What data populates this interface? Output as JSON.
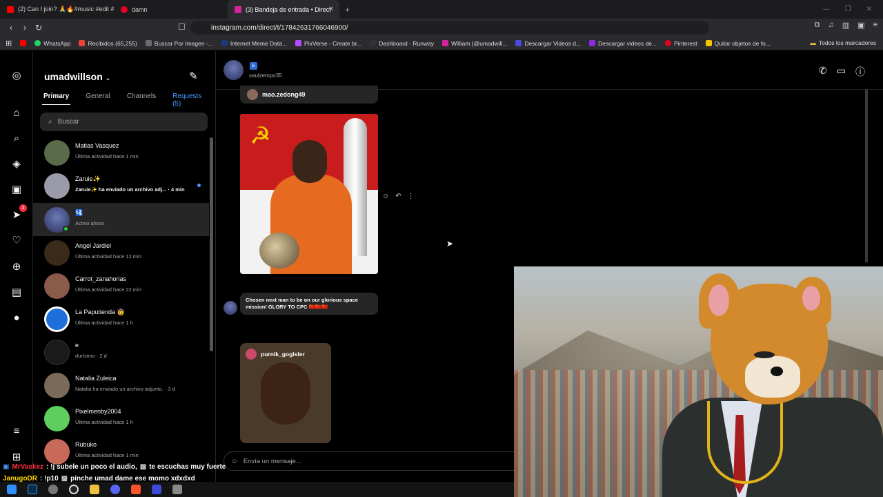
{
  "browser": {
    "tabs": [
      {
        "label": "(2) Can I join? 🙏🔥#music #edit #fo...",
        "color": "#ff0000"
      },
      {
        "label": "damn",
        "color": "#e60023"
      },
      {
        "label": "(3) Bandeja de entrada • Direct",
        "color": "#d6249f"
      }
    ],
    "url": "instagram.com/direct/t/17842631766046900/",
    "bookmarks": [
      {
        "label": "WhatsApp",
        "color": "#25d366"
      },
      {
        "label": "Recibidos (65,255)",
        "color": "#ea4335"
      },
      {
        "label": "Buscar Por Imagen -...",
        "color": "#6b6b6b"
      },
      {
        "label": "Internet Meme Data...",
        "color": "#1a3b7a"
      },
      {
        "label": "PixVerse - Create br...",
        "color": "#b44cff"
      },
      {
        "label": "Dashboard - Runway",
        "color": "#333333"
      },
      {
        "label": "William (@umadwill...",
        "color": "#d6249f"
      },
      {
        "label": "Descargar Videos d...",
        "color": "#4a4ae0"
      },
      {
        "label": "Descargar videos de...",
        "color": "#8a2be2"
      },
      {
        "label": "Pinterest",
        "color": "#e60023"
      },
      {
        "label": "Quitar objetos de fo...",
        "color": "#f5c400"
      }
    ],
    "all_bookmarks_label": "Todos los marcadores"
  },
  "inbox": {
    "username": "umadwillson",
    "tabs": {
      "primary": "Primary",
      "general": "General",
      "channels": "Channels",
      "requests": "Requests (5)"
    },
    "search_placeholder": "Buscar",
    "conversations": [
      {
        "name": "Matias Vasquez",
        "sub": "Última actividad hace 1 min",
        "color": "#5a6b4a"
      },
      {
        "name": "Zaruie✨",
        "sub": "Zaruie✨ ha enviado un archivo adj... · 4 min",
        "color": "#9a9aa8",
        "unread": true
      },
      {
        "name": "🛂",
        "sub": "Activo ahora",
        "color": "#3e4a8a",
        "selected": true
      },
      {
        "name": "Angel Jardiel",
        "sub": "Última actividad hace 12 min",
        "color": "#3a2a1a"
      },
      {
        "name": "Carrot_zanahorias",
        "sub": "Última actividad hace 22 min",
        "color": "#8a5a4a"
      },
      {
        "name": "La Paputienda 🤠",
        "sub": "Última actividad hace 1 h",
        "color": "#1e6fd9"
      },
      {
        "name": "e",
        "sub": "durísimo · 2 d",
        "color": "#1a1a1a"
      },
      {
        "name": "Natalia Zuleica",
        "sub": "Natalia ha enviado un archivo adjunto. · 3 d",
        "color": "#7a6a5a"
      },
      {
        "name": "Pixelmenby2004",
        "sub": "Última actividad hace 1 h",
        "color": "#5ecf5e"
      },
      {
        "name": "Rubuko",
        "sub": "Última actividad hace 1 min",
        "color": "#c86a5a"
      }
    ]
  },
  "rail": {
    "notifications_badge": "3"
  },
  "chat": {
    "header_badge": "🛂",
    "header_sub": "saulzempo35",
    "shared_post_user": "mao.zedong49",
    "caption": "Chosen next man to be on our glorious space mission! GLORY TO CPC 🇨🇳🇨🇳🇨🇳",
    "shared_reel_user": "purnik_gogisler",
    "composer_placeholder": "Envía un mensaje..."
  },
  "stream_chat": [
    {
      "user": "MrVaskez",
      "message": ": !j subele un poco el audio,",
      "message2": "te escuchas muy fuerte"
    },
    {
      "user": "JanugoDR",
      "message": ": !p10",
      "message2": "pinche umad dame ese momo xdxdxd"
    }
  ]
}
